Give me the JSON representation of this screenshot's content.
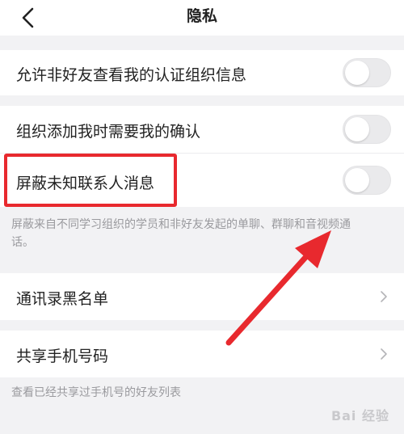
{
  "header": {
    "title": "隐私"
  },
  "settings": [
    {
      "label": "允许非好友查看我的认证组织信息",
      "enabled": false
    },
    {
      "label": "组织添加我时需要我的确认",
      "enabled": false
    },
    {
      "label": "屏蔽未知联系人消息",
      "enabled": false
    }
  ],
  "block_note": "屏蔽来自不同学习组织的学员和非好友发起的单聊、群聊和音视频通话。",
  "links": [
    {
      "label": "通讯录黑名单"
    },
    {
      "label": "共享手机号码"
    }
  ],
  "share_note": "查看已经共享过手机号的好友列表",
  "watermark": "Bai 经验",
  "colors": {
    "highlight": "#e8292e",
    "arrow": "#e8292e"
  }
}
